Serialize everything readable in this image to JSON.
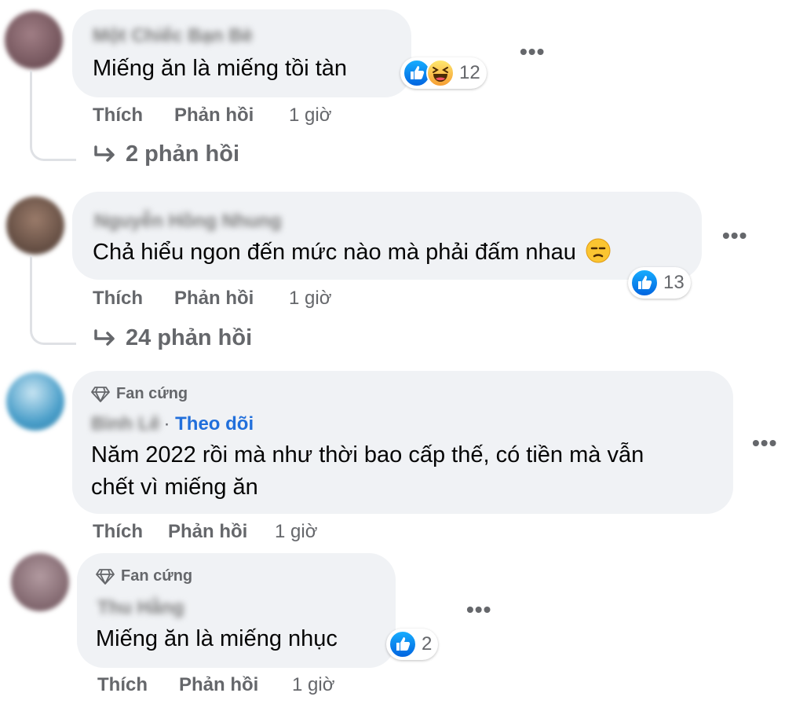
{
  "comments": [
    {
      "author": "Một Chiếc Bạn Bè",
      "text": "Miếng ăn là miếng tồi tàn",
      "reaction_count": "12",
      "reactions": [
        "like-icon",
        "haha-icon"
      ],
      "actions": {
        "like": "Thích",
        "reply": "Phản hồi",
        "time": "1 giờ"
      },
      "replies": "2 phản hồi"
    },
    {
      "author": "Nguyễn Hồng Nhung",
      "text": "Chả hiểu ngon đến mức nào mà phải đấm nhau",
      "reaction_count": "13",
      "reactions": [
        "like-icon"
      ],
      "actions": {
        "like": "Thích",
        "reply": "Phản hồi",
        "time": "1 giờ"
      },
      "replies": "24 phản hồi"
    },
    {
      "badge": "Fan cứng",
      "author": "Bình Lê",
      "follow_sep": "·",
      "follow": "Theo dõi",
      "text_line1": "Năm 2022 rồi mà như thời bao cấp thế, có tiền mà vẫn",
      "text_line2": "chết vì miếng ăn",
      "actions": {
        "like": "Thích",
        "reply": "Phản hồi",
        "time": "1 giờ"
      }
    },
    {
      "badge": "Fan cứng",
      "author": "Thu Hằng",
      "text": "Miếng ăn là miếng nhục",
      "reaction_count": "2",
      "reactions": [
        "like-icon"
      ],
      "actions": {
        "like": "Thích",
        "reply": "Phản hồi",
        "time": "1 giờ"
      }
    }
  ],
  "colors": {
    "bubble": "#f0f2f5",
    "secondary_text": "#65676b",
    "link": "#216fdb",
    "like_blue": "#1877f2"
  }
}
